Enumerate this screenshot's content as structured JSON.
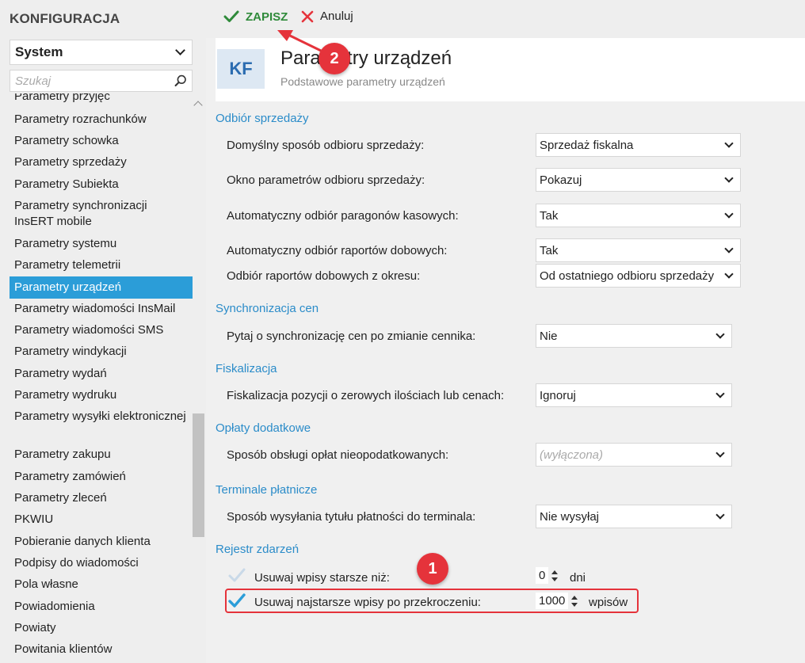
{
  "app": {
    "title": "KONFIGURACJA"
  },
  "sidebar": {
    "module": "System",
    "search_placeholder": "Szukaj",
    "items": [
      {
        "label": "Parametry przyjęć"
      },
      {
        "label": "Parametry rozrachunków"
      },
      {
        "label": "Parametry schowka"
      },
      {
        "label": "Parametry sprzedaży"
      },
      {
        "label": "Parametry Subiekta"
      },
      {
        "label": "Parametry synchronizacji InsERT mobile"
      },
      {
        "label": "Parametry systemu"
      },
      {
        "label": "Parametry telemetrii"
      },
      {
        "label": "Parametry urządzeń",
        "active": true
      },
      {
        "label": "Parametry wiadomości InsMail"
      },
      {
        "label": "Parametry wiadomości SMS"
      },
      {
        "label": "Parametry windykacji"
      },
      {
        "label": "Parametry wydań"
      },
      {
        "label": "Parametry wydruku"
      },
      {
        "label": "Parametry wysyłki elektronicznej"
      },
      {
        "label": "Parametry zakupu"
      },
      {
        "label": "Parametry zamówień"
      },
      {
        "label": "Parametry zleceń"
      },
      {
        "label": "PKWIU"
      },
      {
        "label": "Pobieranie danych klienta"
      },
      {
        "label": "Podpisy do wiadomości"
      },
      {
        "label": "Pola własne"
      },
      {
        "label": "Powiadomienia"
      },
      {
        "label": "Powiaty"
      },
      {
        "label": "Powitania klientów"
      }
    ]
  },
  "toolbar": {
    "save_label": "ZAPISZ",
    "cancel_label": "Anuluj"
  },
  "header": {
    "badge": "KF",
    "title": "Parametry urządzeń",
    "subtitle": "Podstawowe parametry urządzeń"
  },
  "sections": {
    "odbior": {
      "title": "Odbiór sprzedaży",
      "rows": [
        {
          "label": "Domyślny sposób odbioru sprzedaży:",
          "value": "Sprzedaż fiskalna"
        },
        {
          "label": "Okno parametrów odbioru sprzedaży:",
          "value": "Pokazuj"
        },
        {
          "label": "Automatyczny odbiór paragonów kasowych:",
          "value": "Tak"
        },
        {
          "label": "Automatyczny odbiór raportów dobowych:",
          "value": "Tak"
        },
        {
          "label": "Odbiór raportów dobowych z okresu:",
          "value": "Od ostatniego odbioru sprzedaży"
        }
      ]
    },
    "synchronizacja": {
      "title": "Synchronizacja cen",
      "rows": [
        {
          "label": "Pytaj o synchronizację cen po zmianie cennika:",
          "value": "Nie"
        }
      ]
    },
    "fiskalizacja": {
      "title": "Fiskalizacja",
      "rows": [
        {
          "label": "Fiskalizacja pozycji o zerowych ilościach lub cenach:",
          "value": "Ignoruj"
        }
      ]
    },
    "oplaty": {
      "title": "Opłaty dodatkowe",
      "rows": [
        {
          "label": "Sposób obsługi opłat nieopodatkowanych:",
          "value": "(wyłączona)"
        }
      ]
    },
    "terminale": {
      "title": "Terminale płatnicze",
      "rows": [
        {
          "label": "Sposób wysyłania tytułu płatności do terminala:",
          "value": "Nie wysyłaj"
        }
      ]
    },
    "rejestr": {
      "title": "Rejestr zdarzeń",
      "rows": [
        {
          "label": "Usuwaj wpisy starsze niż:",
          "value": "0",
          "unit": "dni",
          "checked": false
        },
        {
          "label": "Usuwaj najstarsze wpisy po przekroczeniu:",
          "value": "1000",
          "unit": "wpisów",
          "checked": true
        }
      ]
    }
  },
  "annotations": {
    "badge1": "1",
    "badge2": "2"
  },
  "colors": {
    "accent": "#2b9dd8",
    "section": "#2b8cc9",
    "save": "#2f8a3a",
    "cancel": "#e5333b",
    "annotation": "#e5333b"
  },
  "icons": {
    "save": "check-icon",
    "cancel": "x-icon",
    "search": "search-icon",
    "select": "chevron-down-icon"
  }
}
